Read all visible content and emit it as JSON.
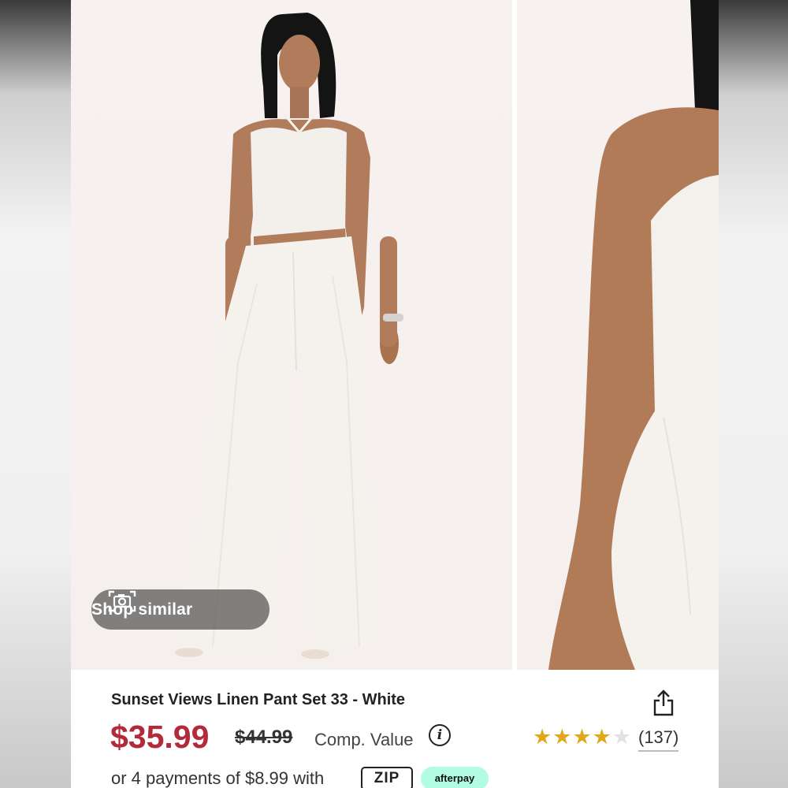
{
  "gallery": {
    "shop_similar_label": "Shop similar",
    "camera_icon": "camera-icon"
  },
  "product": {
    "title": "Sunset Views Linen Pant Set 33 - White",
    "price": "$35.99",
    "original_price": "$44.99",
    "comp_value_label": "Comp. Value",
    "info_icon": "i",
    "rating": 4,
    "rating_max": 5,
    "review_count": "(137)",
    "installments_text": "or 4 payments of $8.99 with",
    "zip_label": "ZIP",
    "afterpay_label": "afterpay"
  },
  "colors": {
    "price": "#b32a3a",
    "star": "#e0a91b",
    "afterpay_bg": "#b2fce4"
  },
  "icons": [
    "camera-icon",
    "share-icon",
    "info-icon",
    "star-icon"
  ]
}
